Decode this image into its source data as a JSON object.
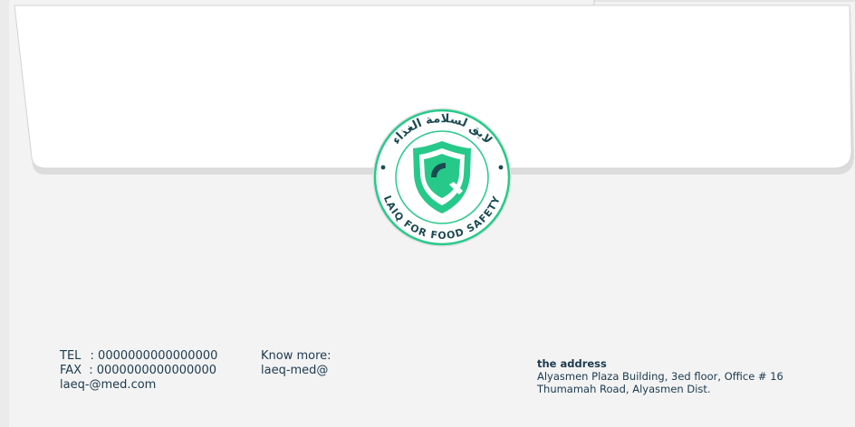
{
  "seal": {
    "arabic_text": "لايق لسلامة الغذاء",
    "english_text": "LAIQ FOR FOOD SAFETY",
    "colors": {
      "green": "#27c98a",
      "dark": "#1b4a52"
    },
    "emblem": "shield-q-icon"
  },
  "contact": {
    "tel_label": "TEL",
    "tel_value": ": 0000000000000000",
    "fax_label": "FAX",
    "fax_value": ": 0000000000000000",
    "email": "laeq-@med.com",
    "know_more_label": "Know more:",
    "know_more_value": "laeq-med@"
  },
  "address": {
    "title": "the address",
    "line1": "Alyasmen Plaza Building, 3ed floor, Office # 16",
    "line2": "Thumamah Road, Alyasmen Dist."
  }
}
